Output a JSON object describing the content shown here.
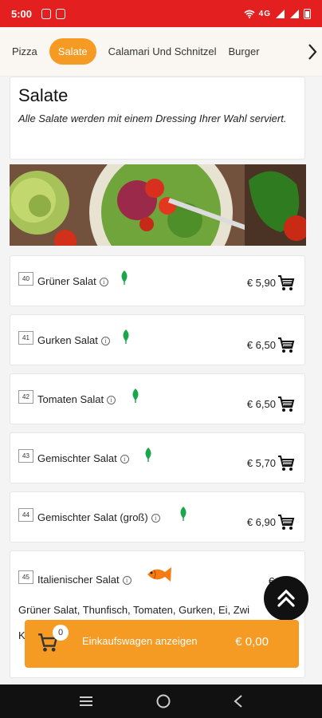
{
  "status_bar": {
    "time": "5:00",
    "signal_text": "4G"
  },
  "categories": {
    "items": [
      "Pizza",
      "Salate",
      "Calamari Und Schnitzel",
      "Burger"
    ],
    "active": "Salate"
  },
  "section": {
    "title": "Salate",
    "description": "Alle Salate werden mit einem Dressing Ihrer Wahl serviert."
  },
  "items": [
    {
      "number": "40",
      "name": "Grüner Salat",
      "price": "€ 5,90",
      "tag": "vegetarian"
    },
    {
      "number": "41",
      "name": "Gurken Salat",
      "price": "€ 6,50",
      "tag": "vegetarian"
    },
    {
      "number": "42",
      "name": "Tomaten Salat",
      "price": "€ 6,50",
      "tag": "vegetarian"
    },
    {
      "number": "43",
      "name": "Gemischter Salat",
      "price": "€ 5,70",
      "tag": "vegetarian"
    },
    {
      "number": "44",
      "name": "Gemischter Salat (groß)",
      "price": "€ 6,90",
      "tag": "vegetarian"
    },
    {
      "number": "45",
      "name": "Italienischer Salat",
      "price": "€ 11,3",
      "tag": "fish",
      "description_line1": "Grüner Salat, Thunfisch, Tomaten, Gurken, Ei, Zwi",
      "description_line2": "K"
    }
  ],
  "cart": {
    "label": "Einkaufswagen anzeigen",
    "total": "€ 0,00",
    "count": "0"
  },
  "colors": {
    "status_bar": "#e41f1f",
    "accent": "#f59a23",
    "leaf": "#1aa64a"
  },
  "icons": [
    "info-icon",
    "leaf-icon",
    "fish-icon",
    "cart-icon",
    "chevron-right-icon",
    "double-chevron-up-icon"
  ]
}
